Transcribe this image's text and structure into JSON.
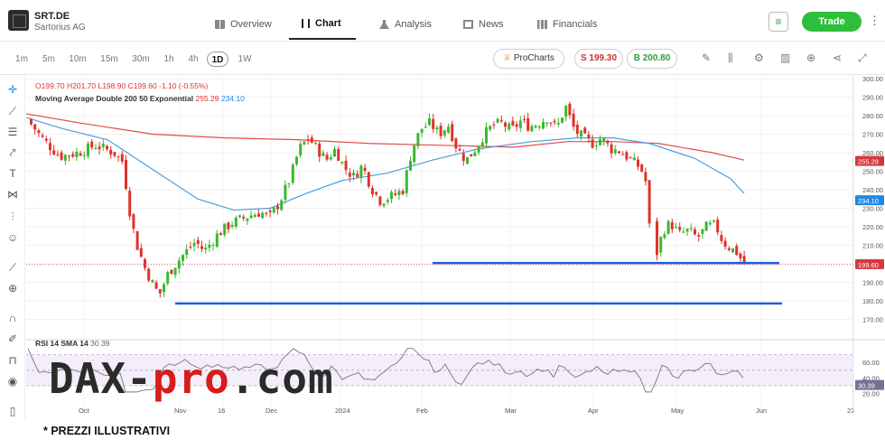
{
  "header": {
    "symbol": "SRT.DE",
    "company": "Sartorius AG",
    "tabs": [
      {
        "label": "Overview",
        "icon": "overview-icon"
      },
      {
        "label": "Chart",
        "icon": "chart-icon",
        "active": true
      },
      {
        "label": "Analysis",
        "icon": "flask-icon"
      },
      {
        "label": "News",
        "icon": "news-icon"
      },
      {
        "label": "Financials",
        "icon": "financials-icon"
      }
    ],
    "trade_label": "Trade",
    "watchlist_icon": "add-watchlist-icon"
  },
  "toolbar": {
    "timeframes": [
      "1m",
      "5m",
      "10m",
      "15m",
      "30m",
      "1h",
      "4h",
      "1D",
      "1W"
    ],
    "active_timeframe": "1D",
    "prochart_label": "ProCharts",
    "sell_label": "S 199.30",
    "buy_label": "B 200.80",
    "icons": [
      "pencil-icon",
      "candles-icon",
      "gear-icon",
      "layout-icon",
      "add-icon",
      "share-icon",
      "expand-icon"
    ]
  },
  "left_tools": [
    "crosshair-icon",
    "trendline-icon",
    "horizontal-lines-icon",
    "ray-icon",
    "text-icon",
    "pattern-icon",
    "measure-icon",
    "emoji-icon",
    "ruler-icon",
    "zoom-icon",
    "magnet-icon",
    "lock-edit-icon",
    "lock-icon",
    "eye-icon",
    "trash-icon"
  ],
  "legend": {
    "ohlc": "O199.70 H201.70 L198.90 C199.60 -1.10 (-0.55%)",
    "ma_label": "Moving Average Double 200 50 Exponential",
    "ma200_value": "255.29",
    "ma50_value": "234.10",
    "rsi_label": "RSI 14 SMA 14",
    "rsi_value": "30.39"
  },
  "price_axis": {
    "ticks": [
      "300.00",
      "290.00",
      "280.00",
      "270.00",
      "260.00",
      "250.00",
      "240.00",
      "230.00",
      "220.00",
      "210.00",
      "200.00",
      "190.00",
      "180.00",
      "170.00"
    ],
    "badges": [
      {
        "value": "255.29",
        "color": "#d9373f"
      },
      {
        "value": "234.10",
        "color": "#1e88e5"
      },
      {
        "value": "199.60",
        "color": "#d9373f"
      }
    ]
  },
  "rsi_axis": {
    "ticks": [
      "60.00",
      "40.00",
      "20.00"
    ],
    "badge": "30.39"
  },
  "time_axis": [
    "Oct",
    "Nov",
    "16",
    "Dec",
    "2024",
    "Feb",
    "Mar",
    "Apr",
    "May",
    "Jun",
    "23"
  ],
  "watermark": {
    "part1": "DAX-",
    "part2": "pro",
    "part3": ".com"
  },
  "note": "* PREZZI ILLUSTRATIVI",
  "colors": {
    "up": "#3db82f",
    "down": "#e0322b",
    "ma200": "#e34a4a",
    "ma50": "#4aa0de",
    "support": "#1f5fd6",
    "trade": "#2fbe3c"
  }
}
